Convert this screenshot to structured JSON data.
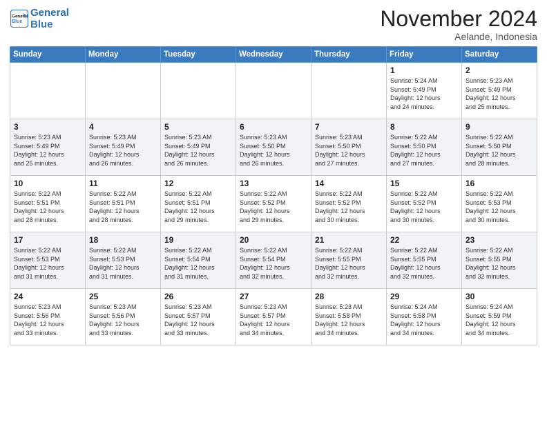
{
  "header": {
    "logo_line1": "General",
    "logo_line2": "Blue",
    "title": "November 2024",
    "subtitle": "Aelande, Indonesia"
  },
  "weekdays": [
    "Sunday",
    "Monday",
    "Tuesday",
    "Wednesday",
    "Thursday",
    "Friday",
    "Saturday"
  ],
  "weeks": [
    [
      {
        "day": "",
        "info": ""
      },
      {
        "day": "",
        "info": ""
      },
      {
        "day": "",
        "info": ""
      },
      {
        "day": "",
        "info": ""
      },
      {
        "day": "",
        "info": ""
      },
      {
        "day": "1",
        "info": "Sunrise: 5:24 AM\nSunset: 5:49 PM\nDaylight: 12 hours\nand 24 minutes."
      },
      {
        "day": "2",
        "info": "Sunrise: 5:23 AM\nSunset: 5:49 PM\nDaylight: 12 hours\nand 25 minutes."
      }
    ],
    [
      {
        "day": "3",
        "info": "Sunrise: 5:23 AM\nSunset: 5:49 PM\nDaylight: 12 hours\nand 25 minutes."
      },
      {
        "day": "4",
        "info": "Sunrise: 5:23 AM\nSunset: 5:49 PM\nDaylight: 12 hours\nand 26 minutes."
      },
      {
        "day": "5",
        "info": "Sunrise: 5:23 AM\nSunset: 5:49 PM\nDaylight: 12 hours\nand 26 minutes."
      },
      {
        "day": "6",
        "info": "Sunrise: 5:23 AM\nSunset: 5:50 PM\nDaylight: 12 hours\nand 26 minutes."
      },
      {
        "day": "7",
        "info": "Sunrise: 5:23 AM\nSunset: 5:50 PM\nDaylight: 12 hours\nand 27 minutes."
      },
      {
        "day": "8",
        "info": "Sunrise: 5:22 AM\nSunset: 5:50 PM\nDaylight: 12 hours\nand 27 minutes."
      },
      {
        "day": "9",
        "info": "Sunrise: 5:22 AM\nSunset: 5:50 PM\nDaylight: 12 hours\nand 28 minutes."
      }
    ],
    [
      {
        "day": "10",
        "info": "Sunrise: 5:22 AM\nSunset: 5:51 PM\nDaylight: 12 hours\nand 28 minutes."
      },
      {
        "day": "11",
        "info": "Sunrise: 5:22 AM\nSunset: 5:51 PM\nDaylight: 12 hours\nand 28 minutes."
      },
      {
        "day": "12",
        "info": "Sunrise: 5:22 AM\nSunset: 5:51 PM\nDaylight: 12 hours\nand 29 minutes."
      },
      {
        "day": "13",
        "info": "Sunrise: 5:22 AM\nSunset: 5:52 PM\nDaylight: 12 hours\nand 29 minutes."
      },
      {
        "day": "14",
        "info": "Sunrise: 5:22 AM\nSunset: 5:52 PM\nDaylight: 12 hours\nand 30 minutes."
      },
      {
        "day": "15",
        "info": "Sunrise: 5:22 AM\nSunset: 5:52 PM\nDaylight: 12 hours\nand 30 minutes."
      },
      {
        "day": "16",
        "info": "Sunrise: 5:22 AM\nSunset: 5:53 PM\nDaylight: 12 hours\nand 30 minutes."
      }
    ],
    [
      {
        "day": "17",
        "info": "Sunrise: 5:22 AM\nSunset: 5:53 PM\nDaylight: 12 hours\nand 31 minutes."
      },
      {
        "day": "18",
        "info": "Sunrise: 5:22 AM\nSunset: 5:53 PM\nDaylight: 12 hours\nand 31 minutes."
      },
      {
        "day": "19",
        "info": "Sunrise: 5:22 AM\nSunset: 5:54 PM\nDaylight: 12 hours\nand 31 minutes."
      },
      {
        "day": "20",
        "info": "Sunrise: 5:22 AM\nSunset: 5:54 PM\nDaylight: 12 hours\nand 32 minutes."
      },
      {
        "day": "21",
        "info": "Sunrise: 5:22 AM\nSunset: 5:55 PM\nDaylight: 12 hours\nand 32 minutes."
      },
      {
        "day": "22",
        "info": "Sunrise: 5:22 AM\nSunset: 5:55 PM\nDaylight: 12 hours\nand 32 minutes."
      },
      {
        "day": "23",
        "info": "Sunrise: 5:22 AM\nSunset: 5:55 PM\nDaylight: 12 hours\nand 32 minutes."
      }
    ],
    [
      {
        "day": "24",
        "info": "Sunrise: 5:23 AM\nSunset: 5:56 PM\nDaylight: 12 hours\nand 33 minutes."
      },
      {
        "day": "25",
        "info": "Sunrise: 5:23 AM\nSunset: 5:56 PM\nDaylight: 12 hours\nand 33 minutes."
      },
      {
        "day": "26",
        "info": "Sunrise: 5:23 AM\nSunset: 5:57 PM\nDaylight: 12 hours\nand 33 minutes."
      },
      {
        "day": "27",
        "info": "Sunrise: 5:23 AM\nSunset: 5:57 PM\nDaylight: 12 hours\nand 34 minutes."
      },
      {
        "day": "28",
        "info": "Sunrise: 5:23 AM\nSunset: 5:58 PM\nDaylight: 12 hours\nand 34 minutes."
      },
      {
        "day": "29",
        "info": "Sunrise: 5:24 AM\nSunset: 5:58 PM\nDaylight: 12 hours\nand 34 minutes."
      },
      {
        "day": "30",
        "info": "Sunrise: 5:24 AM\nSunset: 5:59 PM\nDaylight: 12 hours\nand 34 minutes."
      }
    ]
  ]
}
